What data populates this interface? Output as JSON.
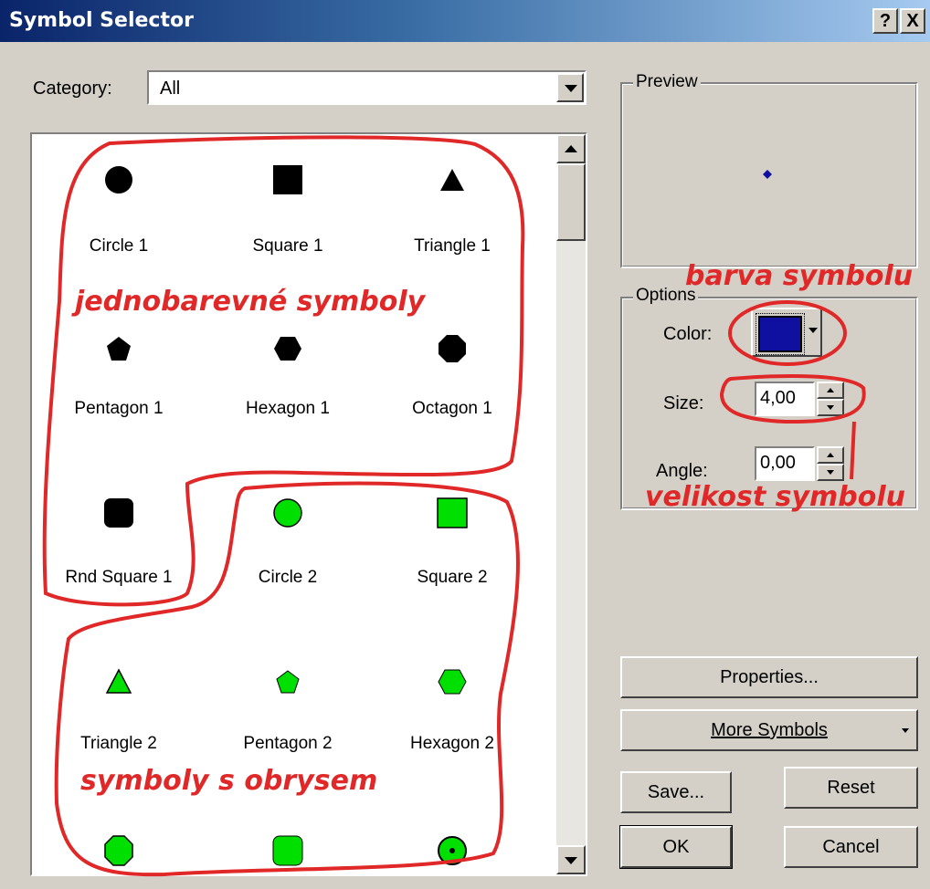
{
  "window": {
    "title": "Symbol Selector",
    "help_btn": "?",
    "close_btn": "X"
  },
  "category": {
    "label": "Category:",
    "value": "All"
  },
  "symbols": [
    {
      "name": "Circle 1"
    },
    {
      "name": "Square 1"
    },
    {
      "name": "Triangle 1"
    },
    {
      "name": "Pentagon 1"
    },
    {
      "name": "Hexagon 1"
    },
    {
      "name": "Octagon 1"
    },
    {
      "name": "Rnd Square 1"
    },
    {
      "name": "Circle 2"
    },
    {
      "name": "Square 2"
    },
    {
      "name": "Triangle 2"
    },
    {
      "name": "Pentagon 2"
    },
    {
      "name": "Hexagon 2"
    }
  ],
  "preview": {
    "label": "Preview"
  },
  "options": {
    "label": "Options",
    "color_label": "Color:",
    "color_value": "#1010a0",
    "size_label": "Size:",
    "size_value": "4,00",
    "angle_label": "Angle:",
    "angle_value": "0,00"
  },
  "buttons": {
    "properties": "Properties...",
    "more_symbols": "More Symbols",
    "save": "Save...",
    "reset": "Reset",
    "ok": "OK",
    "cancel": "Cancel"
  },
  "annotations": {
    "single_color": "jednobarevné symboly",
    "outlined": "symboly s obrysem",
    "symbol_color": "barva symbolu",
    "symbol_size": "velikost symbolu"
  },
  "colors": {
    "accent": "#e02828",
    "symbol_fill_2": "#00e000",
    "title_bar": "#0a246a"
  }
}
